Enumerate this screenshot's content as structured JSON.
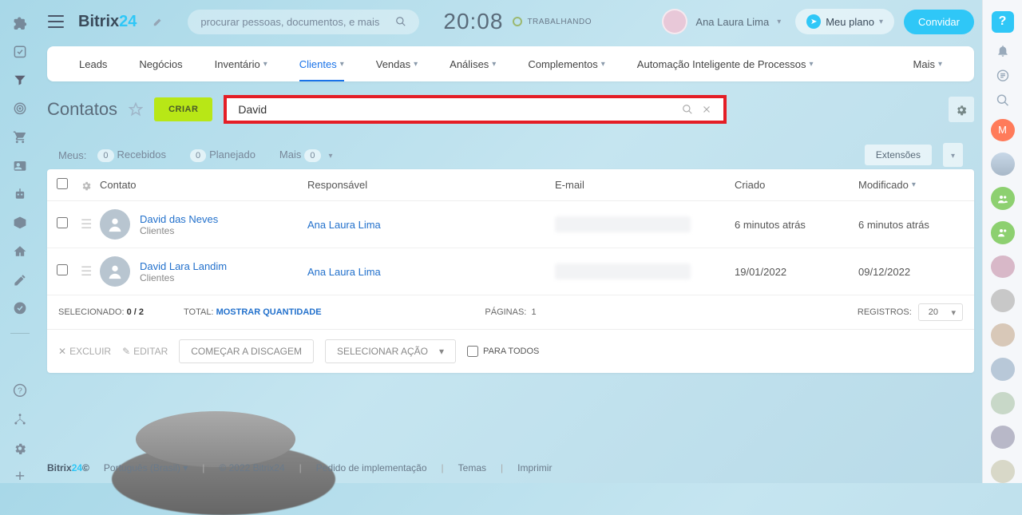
{
  "header": {
    "brand": "Bitrix",
    "brand_num": "24",
    "search_placeholder": "procurar pessoas, documentos, e mais",
    "clock": "20:08",
    "status": "TRABALHANDO",
    "user_name": "Ana Laura Lima",
    "plan_label": "Meu plano",
    "invite_label": "Convidar"
  },
  "nav": {
    "tabs": [
      "Leads",
      "Negócios",
      "Inventário",
      "Clientes",
      "Vendas",
      "Análises",
      "Complementos",
      "Automação Inteligente de Processos"
    ],
    "more": "Mais"
  },
  "title": {
    "text": "Contatos",
    "create": "CRIAR",
    "search_value": "David"
  },
  "filters": {
    "mine": "Meus:",
    "received_count": "0",
    "received": "Recebidos",
    "planned_count": "0",
    "planned": "Planejado",
    "more": "Mais",
    "more_count": "0",
    "extensions": "Extensões"
  },
  "table": {
    "headers": {
      "contact": "Contato",
      "resp": "Responsável",
      "email": "E-mail",
      "created": "Criado",
      "modified": "Modificado"
    },
    "rows": [
      {
        "name": "David das Neves",
        "sub": "Clientes",
        "resp": "Ana Laura Lima",
        "created": "6 minutos atrás",
        "modified": "6 minutos atrás"
      },
      {
        "name": "David Lara Landim",
        "sub": "Clientes",
        "resp": "Ana Laura Lima",
        "created": "19/01/2022",
        "modified": "09/12/2022"
      }
    ],
    "footer": {
      "selected_label": "SELECIONADO:",
      "selected_value": "0 / 2",
      "total_label": "TOTAL:",
      "total_link": "MOSTRAR QUANTIDADE",
      "pages_label": "PÁGINAS:",
      "pages_value": "1",
      "records_label": "REGISTROS:",
      "records_value": "20"
    },
    "actions": {
      "delete": "EXCLUIR",
      "edit": "EDITAR",
      "dial": "COMEÇAR A DISCAGEM",
      "select_action": "SELECIONAR AÇÃO",
      "for_all": "PARA TODOS"
    }
  },
  "footer": {
    "brand": "Bitrix",
    "brand_num": "24",
    "copyright": "©",
    "lang": "Português (Brasil)",
    "year": "© 2022 Bitrix24",
    "impl": "Pedido de implementação",
    "themes": "Temas",
    "print": "Imprimir"
  },
  "rightbar": {
    "m": "M"
  }
}
